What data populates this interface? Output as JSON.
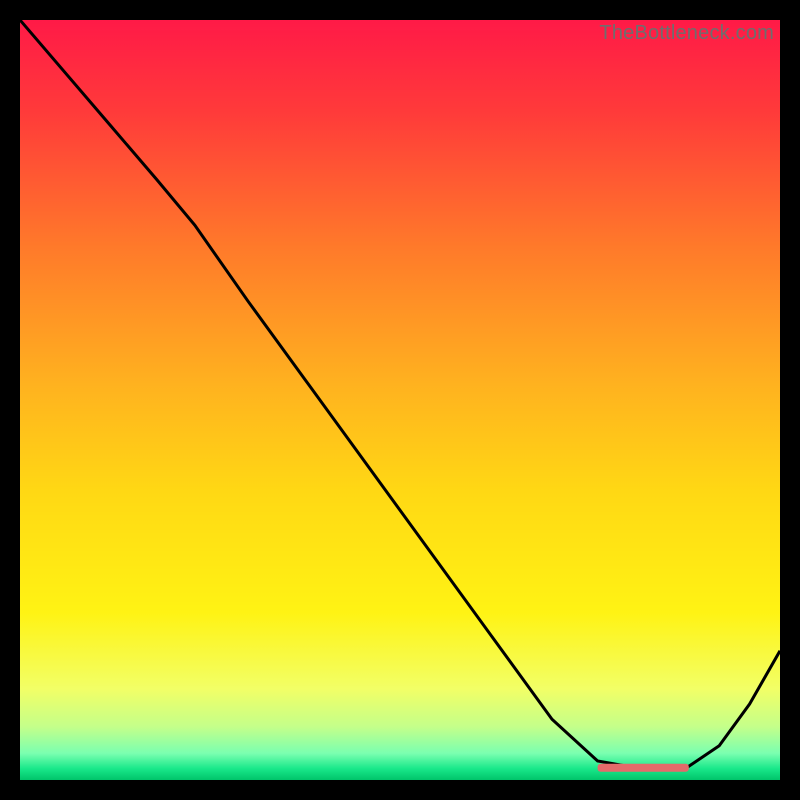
{
  "attribution": "TheBottleneck.com",
  "chart_data": {
    "type": "line",
    "title": "",
    "xlabel": "",
    "ylabel": "",
    "xlim": [
      0,
      100
    ],
    "ylim": [
      0,
      100
    ],
    "grid": false,
    "background": {
      "type": "vertical-gradient",
      "stops": [
        {
          "pos": 0.0,
          "color": "#ff1a47"
        },
        {
          "pos": 0.12,
          "color": "#ff3a3a"
        },
        {
          "pos": 0.3,
          "color": "#ff7a2a"
        },
        {
          "pos": 0.48,
          "color": "#ffb21f"
        },
        {
          "pos": 0.62,
          "color": "#ffd814"
        },
        {
          "pos": 0.78,
          "color": "#fff314"
        },
        {
          "pos": 0.88,
          "color": "#f2ff66"
        },
        {
          "pos": 0.93,
          "color": "#c4ff8a"
        },
        {
          "pos": 0.965,
          "color": "#7affb0"
        },
        {
          "pos": 0.985,
          "color": "#19e88a"
        },
        {
          "pos": 1.0,
          "color": "#00c46a"
        }
      ]
    },
    "series": [
      {
        "name": "bottleneck-curve",
        "color": "#000000",
        "x": [
          0,
          6,
          12,
          18,
          23,
          30,
          38,
          46,
          54,
          62,
          70,
          76,
          80,
          84,
          88,
          92,
          96,
          100
        ],
        "y": [
          100,
          93,
          86,
          79,
          73,
          63,
          52,
          41,
          30,
          19,
          8,
          2.5,
          1.8,
          1.6,
          1.8,
          4.5,
          10,
          17
        ]
      }
    ],
    "marker": {
      "name": "optimal-range",
      "color": "#e46a6a",
      "x_start": 76,
      "x_end": 88,
      "y": 1.6
    }
  }
}
